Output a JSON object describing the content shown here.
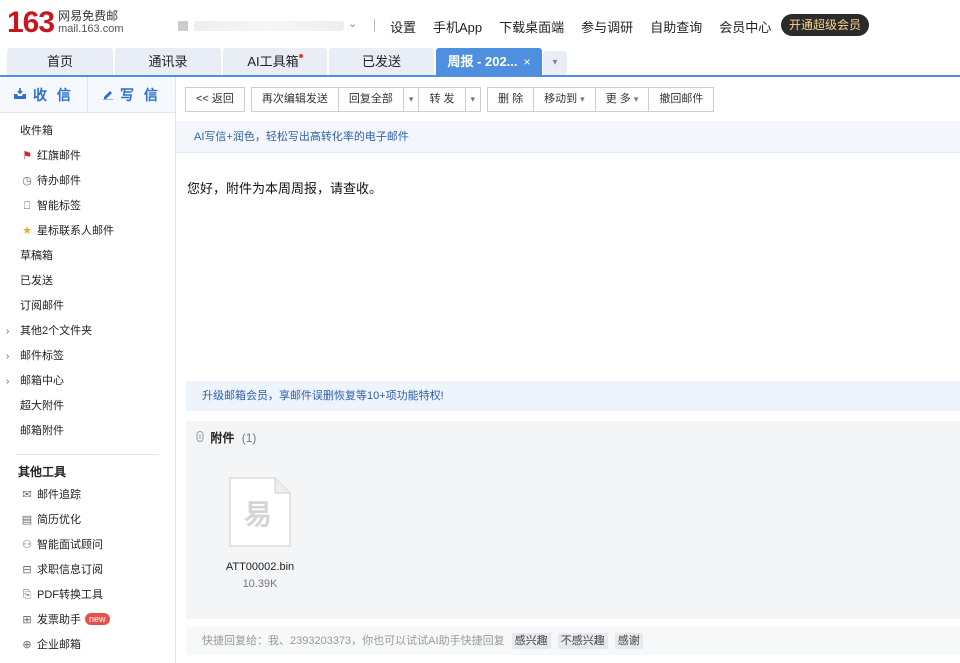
{
  "header": {
    "logo_number": "163",
    "logo_title": "网易免费邮",
    "logo_domain": "mail.163.com",
    "account_chevron": "⌄",
    "links": [
      "设置",
      "手机App",
      "下载桌面端",
      "参与调研",
      "自助查询",
      "会员中心"
    ],
    "vip_button": "开通超级会员"
  },
  "tabs": [
    {
      "label": "首页"
    },
    {
      "label": "通讯录"
    },
    {
      "label": "AI工具箱"
    },
    {
      "label": "已发送"
    },
    {
      "label": "周报 - 202..."
    }
  ],
  "tab_close": "×",
  "sidebar": {
    "receive_label": "收 信",
    "write_label": "写 信",
    "items": [
      {
        "label": "收件箱"
      },
      {
        "label": "红旗邮件"
      },
      {
        "label": "待办邮件"
      },
      {
        "label": "智能标签"
      },
      {
        "label": "星标联系人邮件"
      },
      {
        "label": "草稿箱"
      },
      {
        "label": "已发送"
      },
      {
        "label": "订阅邮件"
      },
      {
        "label": "其他2个文件夹"
      },
      {
        "label": "邮件标签"
      },
      {
        "label": "邮箱中心"
      },
      {
        "label": "超大附件"
      },
      {
        "label": "邮箱附件"
      }
    ],
    "tools_title": "其他工具",
    "tools": [
      {
        "label": "邮件追踪"
      },
      {
        "label": "简历优化"
      },
      {
        "label": "智能面试顾问"
      },
      {
        "label": "求职信息订阅"
      },
      {
        "label": "PDF转换工具"
      },
      {
        "label": "发票助手",
        "badge": "new"
      },
      {
        "label": "企业邮箱"
      }
    ]
  },
  "toolbar": {
    "back": "<< 返回",
    "edit_resend": "再次编辑发送",
    "reply_all": "回复全部",
    "forward": "转 发",
    "delete": "删 除",
    "move_to": "移动到",
    "more": "更 多",
    "recall": "撤回邮件"
  },
  "ai_banner": "AI写信+润色，轻松写出高转化率的电子邮件",
  "message_body": "您好，附件为本周周报，请查收。",
  "upgrade_banner": "升级邮箱会员，享邮件误删恢复等10+项功能特权!",
  "attachments": {
    "label": "附件",
    "count": "(1)",
    "files": [
      {
        "name": "ATT00002.bin",
        "size": "10.39K",
        "icon_glyph": "易"
      }
    ]
  },
  "quick_reply": {
    "placeholder": "快捷回复给：我、2393203373，你也可以试试AI助手快捷回复",
    "chips": [
      "感兴趣",
      "不感兴趣",
      "感谢"
    ]
  },
  "colors": {
    "brand_red": "#c8161d",
    "accent_blue": "#4f8fe0",
    "link_blue": "#2f6fcb"
  }
}
